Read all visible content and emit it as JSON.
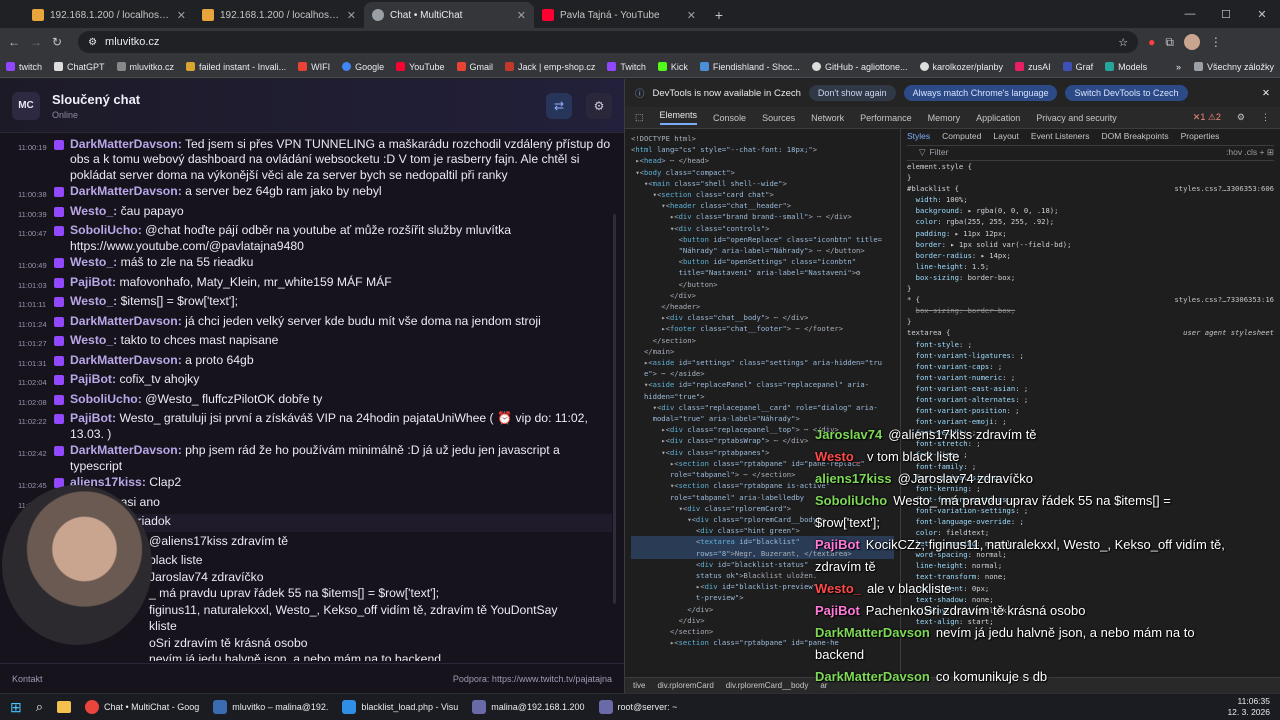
{
  "browser": {
    "tabs": [
      {
        "title": "192.168.1.200 / localhost / mlu",
        "color": "#e8a53b"
      },
      {
        "title": "192.168.1.200 / localhost / mlu",
        "color": "#e8a53b"
      },
      {
        "title": "Chat • MultiChat",
        "color": "#9aa0a6"
      },
      {
        "title": "Pavla Tajná - YouTube",
        "color": "#ff0033"
      }
    ],
    "url": "mluvitko.cz",
    "bookmarks": [
      "twitch",
      "ChatGPT",
      "mluvitko.cz",
      "failed instant - Invali...",
      "WIFI",
      "Google",
      "YouTube",
      "Gmail",
      "Jack | emp-shop.cz",
      "Twitch",
      "Kick",
      "Fiendishland - Shoc...",
      "GitHub - agliottone...",
      "karolkozer/planby",
      "zusAI",
      "Graf",
      "Models"
    ],
    "bookmarks_all": "Všechny záložky"
  },
  "chat": {
    "logo": "MC",
    "title": "Sloučený chat",
    "status": "Online",
    "messages": [
      {
        "ts": "",
        "user": "DarkMatterDavson:",
        "text": "Ted jsem si přes VPN TUNNELING a maškarádu rozchodil vzdálený přístup do obs a k tomu webový dashboard na ovládání websocketu :D V tom je rasberry fajn. Ale chtěl si pokládat server doma na výkonější věci ale za server bych se nedopaltil při ranky",
        "ts2": "11:00:19"
      },
      {
        "ts": "11:00:38",
        "user": "DarkMatterDavson:",
        "text": "a server bez 64gb ram jako by nebyl"
      },
      {
        "ts": "11:00:39",
        "user": "Westo_:",
        "text": "čau papayo"
      },
      {
        "ts": "11:00:47",
        "user": "SoboliUcho:",
        "text": "@chat hoďte pájí odběr na youtube ať může rozšířit služby mluvítka https://www.youtube.com/@pavlatajna9480"
      },
      {
        "ts": "11:00:49",
        "user": "Westo_:",
        "text": "máš to zle na 55 rieadku"
      },
      {
        "ts": "11:01:03",
        "user": "PajiBot:",
        "text": "mafovonhafo, Maty_Klein, mr_white159 MÁF MÁF"
      },
      {
        "ts": "11:01:11",
        "user": "Westo_:",
        "text": "$items[] = $row['text'];"
      },
      {
        "ts": "11:01:24",
        "user": "DarkMatterDavson:",
        "text": "já chci jeden velký server kde budu mít vše doma na jendom stroji"
      },
      {
        "ts": "11:01:27",
        "user": "Westo_:",
        "text": "takto to chces mast napisane"
      },
      {
        "ts": "11:01:31",
        "user": "DarkMatterDavson:",
        "text": "a proto 64gb"
      },
      {
        "ts": "11:02:04",
        "user": "PajiBot:",
        "text": "cofix_tv ahojky"
      },
      {
        "ts": "11:02:08",
        "user": "SoboliUcho:",
        "text": "@Westo_ fluffczPilotOK dobře ty"
      },
      {
        "ts": "11:02:22",
        "user": "PajiBot:",
        "text": "Westo_ gratuluji jsi první a získáváš VIP na 24hodin pajataUniWhee ( ⏰ vip do: 11:02, 13.03. )"
      },
      {
        "ts": "11:02:42",
        "user": "DarkMatterDavson:",
        "text": "php jsem rád že ho používám minimálně :D já už jedu jen javascript a typescript"
      },
      {
        "ts": "11:02:45",
        "user": "aliens17kiss:",
        "text": "Clap2"
      },
      {
        "ts": "11:02:47",
        "user": "Westo_:",
        "text": "asi ano"
      },
      {
        "ts": "11:02:56",
        "user": "Westo_:",
        "text": "55 riadok"
      },
      {
        "ts": "11:03:12",
        "user": "",
        "text": "@aliens17kiss zdravím tě"
      },
      {
        "ts": "",
        "user": "",
        "text": "black liste"
      },
      {
        "ts": "",
        "user": "",
        "text": "Jaroslav74 zdravíčko"
      },
      {
        "ts": "",
        "user": "",
        "text": "_ má pravdu uprav řádek 55 na $items[] = $row['text'];"
      },
      {
        "ts": "",
        "user": "",
        "text": "figinus11, naturalekxxl, Westo_, Kekso_off vidím tě, zdravím tě YouDontSay"
      },
      {
        "ts": "",
        "user": "",
        "text": "kliste"
      },
      {
        "ts": "",
        "user": "",
        "text": "oSri zdravím tě krásná osobo"
      },
      {
        "ts": "",
        "user": "",
        "text": "nevím já jedu halvně json, a nebo mám na to backend"
      },
      {
        "ts": "",
        "user": "",
        "text": "co komunikuje s db"
      },
      {
        "ts": "11:06:",
        "user": "",
        "text": "go je halvně hard"
      }
    ],
    "footer_left": "Kontakt",
    "footer_right": "Podpora: https://www.twitch.tv/pajatajna"
  },
  "devtools": {
    "notice": "DevTools is now available in Czech",
    "btn_dont_show": "Don't show again",
    "btn_match": "Always match Chrome's language",
    "btn_switch": "Switch DevTools to Czech",
    "tabs": [
      "Elements",
      "Console",
      "Sources",
      "Network",
      "Performance",
      "Memory",
      "Application",
      "Privacy and security"
    ],
    "style_tabs": [
      "Styles",
      "Computed",
      "Layout",
      "Event Listeners",
      "DOM Breakpoints",
      "Properties"
    ],
    "filter": "Filter",
    "crumbs": [
      "tive",
      "div.rploremCard",
      "div.rploremCard__body",
      "ar"
    ]
  },
  "overlay": [
    {
      "user": "Jaroslav74",
      "text": "@aliens17kiss zdravím tě",
      "color": "#7ed957"
    },
    {
      "user": "Westo_",
      "text": "v tom black liste",
      "color": "#ff4a4a"
    },
    {
      "user": "aliens17kiss",
      "text": "@Jaroslav74 zdravíčko",
      "color": "#7ed957"
    },
    {
      "user": "SoboliUcho",
      "text": "Westo_ má pravdu uprav řádek 55 na $items[] =",
      "color": "#7ed957"
    },
    {
      "user": "",
      "text": "$row['text'];",
      "color": "#ffffff"
    },
    {
      "user": "PajiBot",
      "text": "KocikCZz, figinus11, naturalekxxl, Westo_, Kekso_off vidím tě,",
      "color": "#ff7ad9"
    },
    {
      "user": "",
      "text": "zdravím tě",
      "color": "#ffffff"
    },
    {
      "user": "Westo_",
      "text": "ale v blackliste",
      "color": "#ff4a4a"
    },
    {
      "user": "PajiBot",
      "text": "PachenkoSri zdravím tě krásná osobo",
      "color": "#ff7ad9"
    },
    {
      "user": "DarkMatterDavson",
      "text": "nevím já jedu halvně json, a nebo mám na to",
      "color": "#7ed957"
    },
    {
      "user": "",
      "text": "backend",
      "color": "#ffffff"
    },
    {
      "user": "DarkMatterDavson",
      "text": "co komunikuje s db",
      "color": "#7ed957"
    },
    {
      "user": "DarkMatterDavson",
      "text": "go je halvně hard",
      "color": "#7ed957"
    }
  ],
  "taskbar": {
    "items": [
      "Chat • MultiChat - Goog",
      "mluvitko – malina@192.",
      "blacklist_load.php - Visu",
      "malina@192.168.1.200",
      "root@server: ~"
    ],
    "time": "11:06:35",
    "date": "12. 3. 2026"
  }
}
